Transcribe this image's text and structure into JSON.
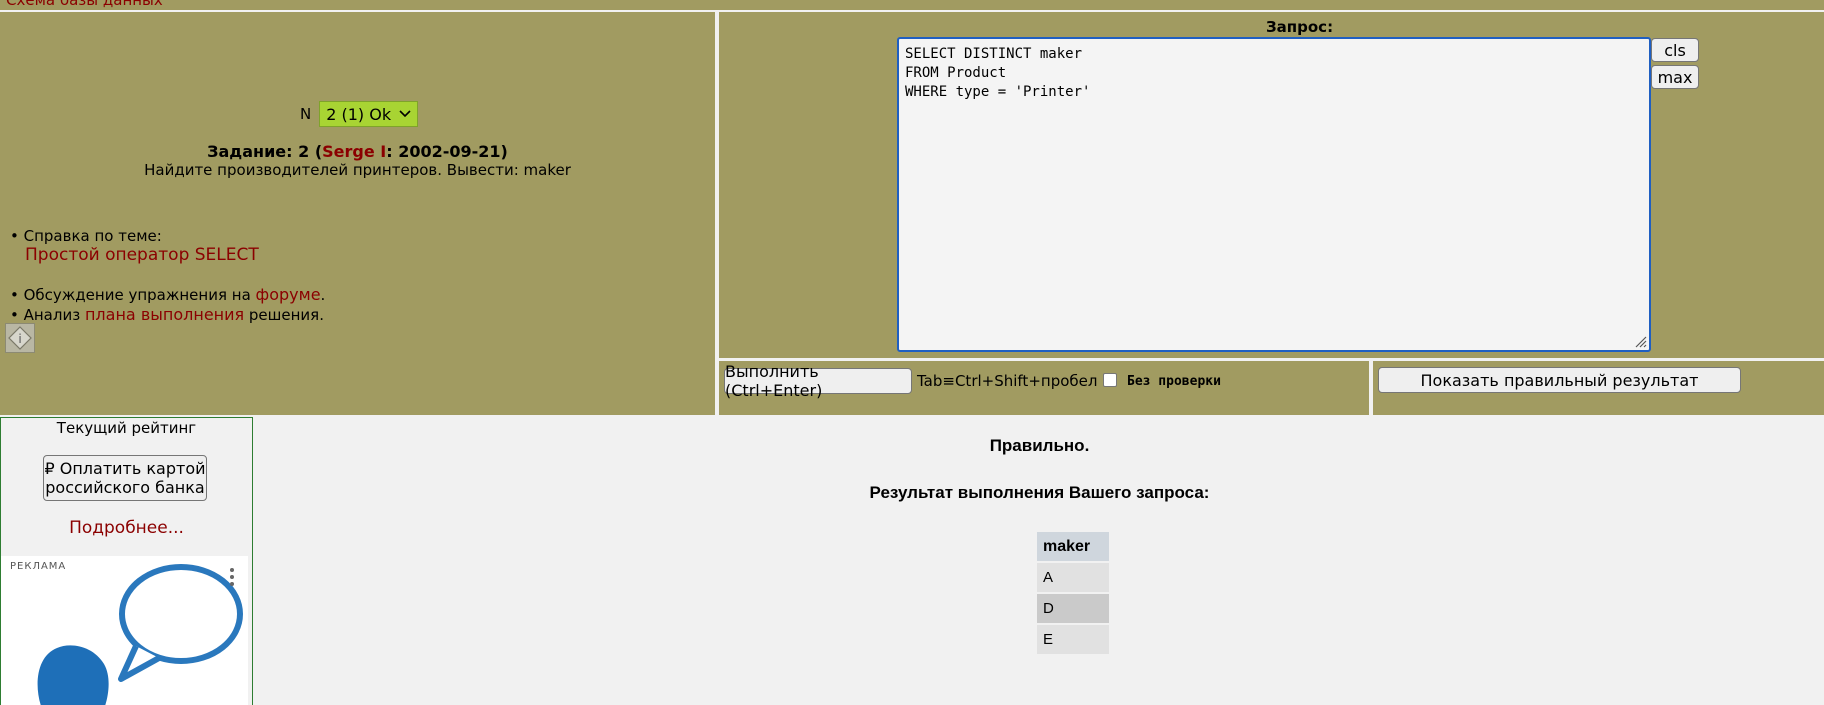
{
  "top": {
    "text": "Схема базы данных"
  },
  "task": {
    "n_label": "N",
    "selected": "2 (1) Ok",
    "title_prefix": "Задание: 2 (",
    "author": "Serge I",
    "title_suffix": ": 2002-09-21)",
    "description": "Найдите производителей принтеров. Вывести: maker"
  },
  "help": {
    "label": "• Справка по теме:",
    "link": "Простой оператор SELECT",
    "forum_prefix": "• Обсуждение упражнения на ",
    "forum_link": "форуме",
    "forum_suffix": ".",
    "plan_prefix": "• Анализ ",
    "plan_link": "плана выполнения",
    "plan_suffix": " решения."
  },
  "query": {
    "label": "Запрос:",
    "text": "SELECT DISTINCT maker\nFROM Product\nWHERE type = 'Printer'",
    "cls_label": "cls",
    "max_label": "max"
  },
  "toolbar": {
    "run_label": "Выполнить (Ctrl+Enter)",
    "shortcut": "Tab≡Ctrl+Shift+пробел",
    "nocheck_label": "Без проверки",
    "show_label": "Показать правильный результат"
  },
  "rating": {
    "title": "Текущий рейтинг",
    "pay_label": "₽ Оплатить картой российского банка",
    "more_link": "Подробнее...",
    "ad_label": "РЕКЛАМА"
  },
  "result": {
    "status": "Правильно.",
    "title": "Результат выполнения Вашего запроса:",
    "columns": [
      "maker"
    ],
    "rows": [
      "A",
      "D",
      "E"
    ]
  },
  "colors": {
    "panel": "#a19b61",
    "link": "#8b0000",
    "select": "#a8d433",
    "focus": "#1f5fc2"
  }
}
